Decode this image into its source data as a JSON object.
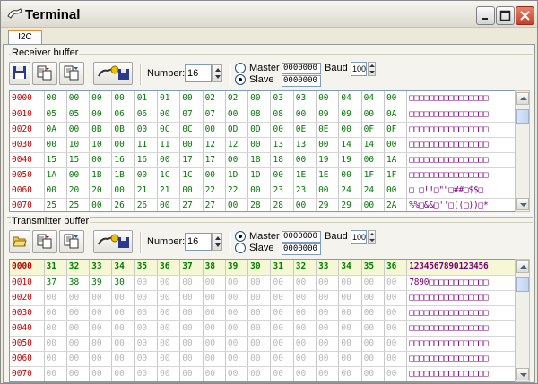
{
  "window": {
    "title": "Terminal"
  },
  "tabs": [
    {
      "label": "I2C"
    }
  ],
  "receiver": {
    "label": "Receiver buffer",
    "number_label": "Number:",
    "number_value": "16",
    "master_label": "Master",
    "slave_label": "Slave",
    "master_addr": "0000000",
    "slave_addr": "0000000",
    "baud_label": "Baud",
    "baud_value": "100",
    "selected_mode": "slave",
    "rows": [
      {
        "addr": "0000",
        "hex": [
          "00",
          "00",
          "00",
          "00",
          "01",
          "01",
          "00",
          "02",
          "02",
          "00",
          "03",
          "03",
          "00",
          "04",
          "04",
          "00"
        ],
        "ascii": "□□□□□□□□□□□□□□□□"
      },
      {
        "addr": "0010",
        "hex": [
          "05",
          "05",
          "00",
          "06",
          "06",
          "00",
          "07",
          "07",
          "00",
          "08",
          "08",
          "00",
          "09",
          "09",
          "00",
          "0A"
        ],
        "ascii": "□□□□□□□□□□□□□□□□"
      },
      {
        "addr": "0020",
        "hex": [
          "0A",
          "00",
          "0B",
          "0B",
          "00",
          "0C",
          "0C",
          "00",
          "0D",
          "0D",
          "00",
          "0E",
          "0E",
          "00",
          "0F",
          "0F"
        ],
        "ascii": "□□□□□□□□□□□□□□□□"
      },
      {
        "addr": "0030",
        "hex": [
          "00",
          "10",
          "10",
          "00",
          "11",
          "11",
          "00",
          "12",
          "12",
          "00",
          "13",
          "13",
          "00",
          "14",
          "14",
          "00"
        ],
        "ascii": "□□□□□□□□□□□□□□□□"
      },
      {
        "addr": "0040",
        "hex": [
          "15",
          "15",
          "00",
          "16",
          "16",
          "00",
          "17",
          "17",
          "00",
          "18",
          "18",
          "00",
          "19",
          "19",
          "00",
          "1A"
        ],
        "ascii": "□□□□□□□□□□□□□□□□"
      },
      {
        "addr": "0050",
        "hex": [
          "1A",
          "00",
          "1B",
          "1B",
          "00",
          "1C",
          "1C",
          "00",
          "1D",
          "1D",
          "00",
          "1E",
          "1E",
          "00",
          "1F",
          "1F"
        ],
        "ascii": "□□□□□□□□□□□□□□□□"
      },
      {
        "addr": "0060",
        "hex": [
          "00",
          "20",
          "20",
          "00",
          "21",
          "21",
          "00",
          "22",
          "22",
          "00",
          "23",
          "23",
          "00",
          "24",
          "24",
          "00"
        ],
        "ascii": "□ □!!□\"\"□##□$$□"
      },
      {
        "addr": "0070",
        "hex": [
          "25",
          "25",
          "00",
          "26",
          "26",
          "00",
          "27",
          "27",
          "00",
          "28",
          "28",
          "00",
          "29",
          "29",
          "00",
          "2A"
        ],
        "ascii": "%%□&&□''□((□))□*"
      }
    ]
  },
  "transmitter": {
    "label": "Transmitter buffer",
    "number_label": "Number:",
    "number_value": "16",
    "master_label": "Master",
    "slave_label": "Slave",
    "master_addr": "0000000",
    "slave_addr": "0000000",
    "baud_label": "Baud",
    "baud_value": "100",
    "selected_mode": "master",
    "rows": [
      {
        "addr": "0000",
        "hex": [
          "31",
          "32",
          "33",
          "34",
          "35",
          "36",
          "37",
          "38",
          "39",
          "30",
          "31",
          "32",
          "33",
          "34",
          "35",
          "36"
        ],
        "ascii": "1234567890123456"
      },
      {
        "addr": "0010",
        "hex": [
          "37",
          "38",
          "39",
          "30",
          "00",
          "00",
          "00",
          "00",
          "00",
          "00",
          "00",
          "00",
          "00",
          "00",
          "00",
          "00"
        ],
        "ascii": "7890□□□□□□□□□□□□"
      },
      {
        "addr": "0020",
        "hex": [
          "00",
          "00",
          "00",
          "00",
          "00",
          "00",
          "00",
          "00",
          "00",
          "00",
          "00",
          "00",
          "00",
          "00",
          "00",
          "00"
        ],
        "ascii": "□□□□□□□□□□□□□□□□"
      },
      {
        "addr": "0030",
        "hex": [
          "00",
          "00",
          "00",
          "00",
          "00",
          "00",
          "00",
          "00",
          "00",
          "00",
          "00",
          "00",
          "00",
          "00",
          "00",
          "00"
        ],
        "ascii": "□□□□□□□□□□□□□□□□"
      },
      {
        "addr": "0040",
        "hex": [
          "00",
          "00",
          "00",
          "00",
          "00",
          "00",
          "00",
          "00",
          "00",
          "00",
          "00",
          "00",
          "00",
          "00",
          "00",
          "00"
        ],
        "ascii": "□□□□□□□□□□□□□□□□"
      },
      {
        "addr": "0050",
        "hex": [
          "00",
          "00",
          "00",
          "00",
          "00",
          "00",
          "00",
          "00",
          "00",
          "00",
          "00",
          "00",
          "00",
          "00",
          "00",
          "00"
        ],
        "ascii": "□□□□□□□□□□□□□□□□"
      },
      {
        "addr": "0060",
        "hex": [
          "00",
          "00",
          "00",
          "00",
          "00",
          "00",
          "00",
          "00",
          "00",
          "00",
          "00",
          "00",
          "00",
          "00",
          "00",
          "00"
        ],
        "ascii": "□□□□□□□□□□□□□□□□"
      },
      {
        "addr": "0070",
        "hex": [
          "00",
          "00",
          "00",
          "00",
          "00",
          "00",
          "00",
          "00",
          "00",
          "00",
          "00",
          "00",
          "00",
          "00",
          "00",
          "00"
        ],
        "ascii": "□□□□□□□□□□□□□□□□"
      }
    ]
  },
  "colors": {
    "address": "#c00000",
    "hex": "#007a00",
    "ascii": "#7a007a",
    "highlight_row": "#f6f7d4"
  },
  "icons": {
    "titlebar": "terminal-cable-icon",
    "receiver_toolbar": [
      "save-icon",
      "copy-page-icon",
      "paste-page-icon",
      "capture-to-disk-icon"
    ],
    "transmitter_toolbar": [
      "open-folder-icon",
      "copy-page-icon",
      "paste-page-icon",
      "capture-to-disk-icon"
    ]
  }
}
